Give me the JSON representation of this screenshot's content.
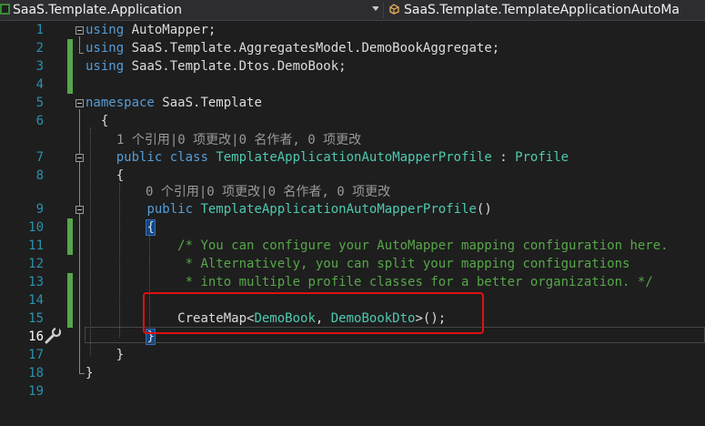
{
  "nav": {
    "project": "SaaS.Template.Application",
    "class": "SaaS.Template.TemplateApplicationAutoMa"
  },
  "editor": {
    "line_numbers": [
      "1",
      "2",
      "3",
      "4",
      "5",
      "6",
      "7",
      "8",
      "9",
      "10",
      "11",
      "12",
      "13",
      "14",
      "15",
      "16",
      "17",
      "18",
      "19"
    ],
    "using1": "AutoMapper;",
    "using2": "SaaS.Template.AggregatesModel.DemoBookAggregate;",
    "using3": "SaaS.Template.Dtos.DemoBook;",
    "namespace_name": "SaaS.Template",
    "lens_class": "1 个引用|0 项更改|0 名作者, 0 项更改",
    "class_name": "TemplateApplicationAutoMapperProfile",
    "base_class": "Profile",
    "lens_ctor": "0 个引用|0 项更改|0 名作者, 0 项更改",
    "ctor_name": "TemplateApplicationAutoMapperProfile",
    "comment1": "/* You can configure your AutoMapper mapping configuration here.",
    "comment2": " * Alternatively, you can split your mapping configurations",
    "comment3": " * into multiple profile classes for a better organization. */",
    "createmap": "CreateMap",
    "type_src": "DemoBook",
    "type_dst": "DemoBookDto"
  },
  "colors": {
    "keyword": "#569cd6",
    "type": "#4ec9b0",
    "comment": "#57a64a",
    "line_number": "#2b91af",
    "highlight_box": "#e01010"
  }
}
